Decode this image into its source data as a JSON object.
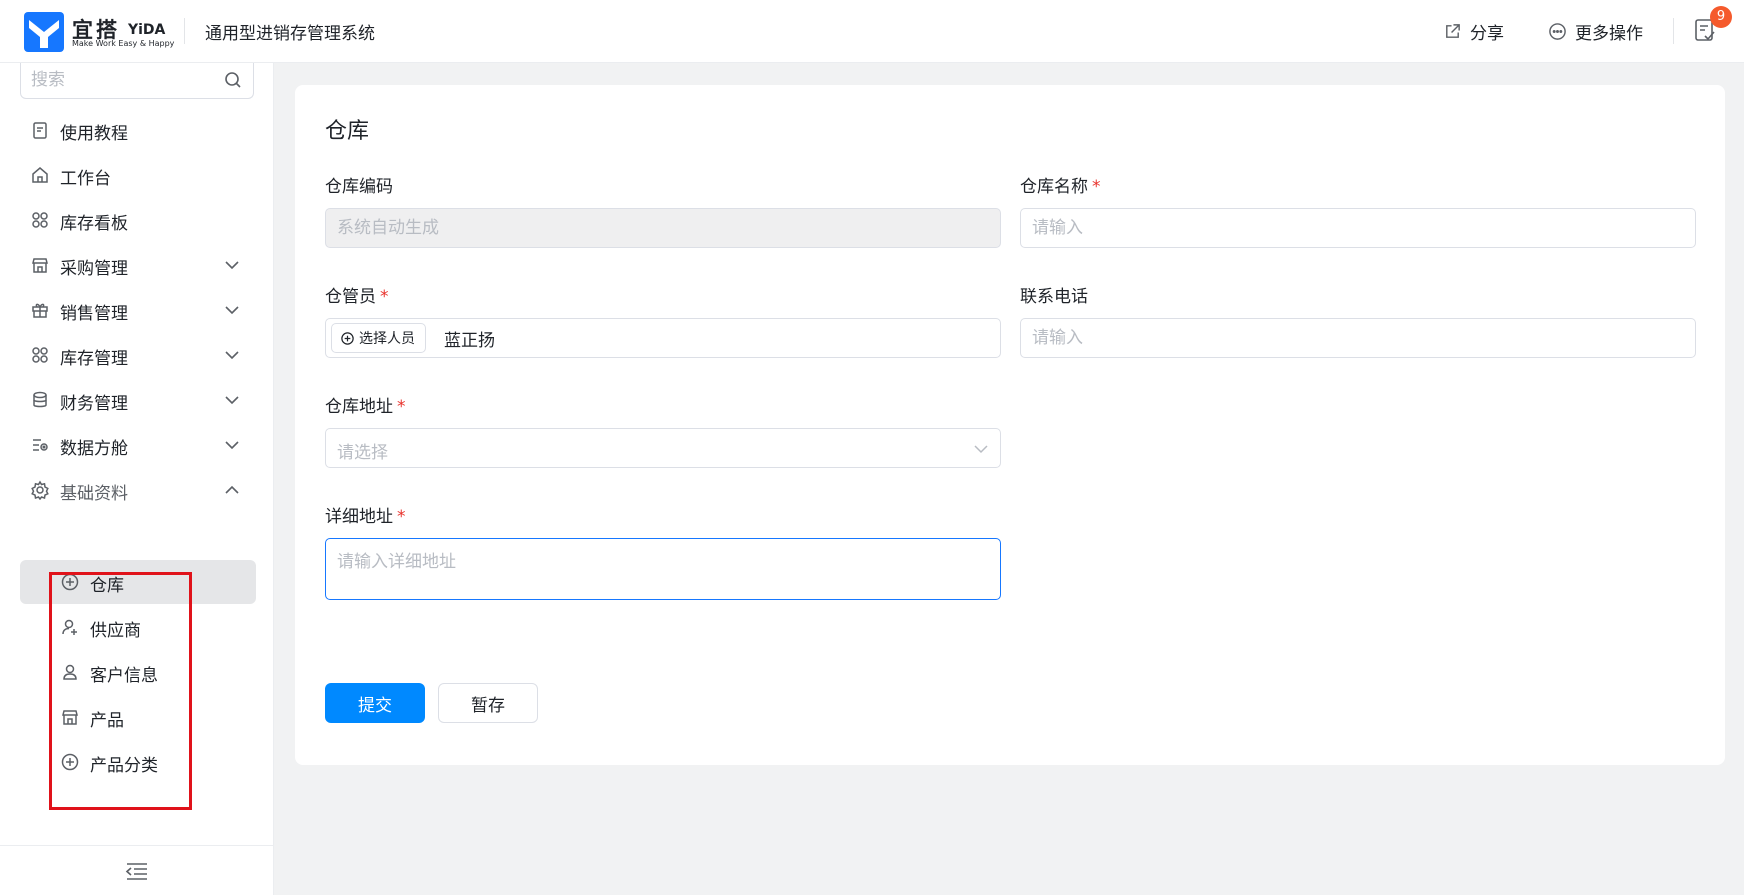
{
  "header": {
    "logo_cn": "宜搭",
    "logo_en": "YiDA",
    "logo_tagline": "Make Work Easy & Happy",
    "app_title": "通用型进销存管理系统",
    "share_label": "分享",
    "more_label": "更多操作",
    "todo_badge": "9"
  },
  "sidebar": {
    "search_placeholder": "搜索",
    "items": [
      {
        "label": "使用教程",
        "icon": "document-icon"
      },
      {
        "label": "工作台",
        "icon": "home-icon"
      },
      {
        "label": "库存看板",
        "icon": "grid-icon"
      },
      {
        "label": "采购管理",
        "icon": "store-icon",
        "expandable": true
      },
      {
        "label": "销售管理",
        "icon": "gift-icon",
        "expandable": true
      },
      {
        "label": "库存管理",
        "icon": "grid-icon",
        "expandable": true
      },
      {
        "label": "财务管理",
        "icon": "database-icon",
        "expandable": true
      },
      {
        "label": "数据方舱",
        "icon": "data-list-icon",
        "expandable": true
      },
      {
        "label": "基础资料",
        "icon": "gear-icon",
        "expanded": true
      }
    ],
    "sub_items": [
      {
        "label": "仓库",
        "icon": "plus-circle-icon",
        "active": true
      },
      {
        "label": "供应商",
        "icon": "user-add-icon"
      },
      {
        "label": "客户信息",
        "icon": "user-icon"
      },
      {
        "label": "产品",
        "icon": "store-icon"
      },
      {
        "label": "产品分类",
        "icon": "plus-circle-icon"
      }
    ]
  },
  "form": {
    "title": "仓库",
    "code_label": "仓库编码",
    "code_value": "系统自动生成",
    "name_label": "仓库名称",
    "name_placeholder": "请输入",
    "keeper_label": "仓管员",
    "keeper_button": "选择人员",
    "keeper_value": "蓝正扬",
    "phone_label": "联系电话",
    "phone_placeholder": "请输入",
    "address_label": "仓库地址",
    "address_placeholder": "请选择",
    "detail_label": "详细地址",
    "detail_placeholder": "请输入详细地址",
    "required_mark": "*",
    "submit_label": "提交",
    "draft_label": "暂存"
  },
  "colors": {
    "primary": "#0089ff",
    "required": "#e8322c",
    "badge": "#f55a2c",
    "highlight": "#e0121a"
  }
}
